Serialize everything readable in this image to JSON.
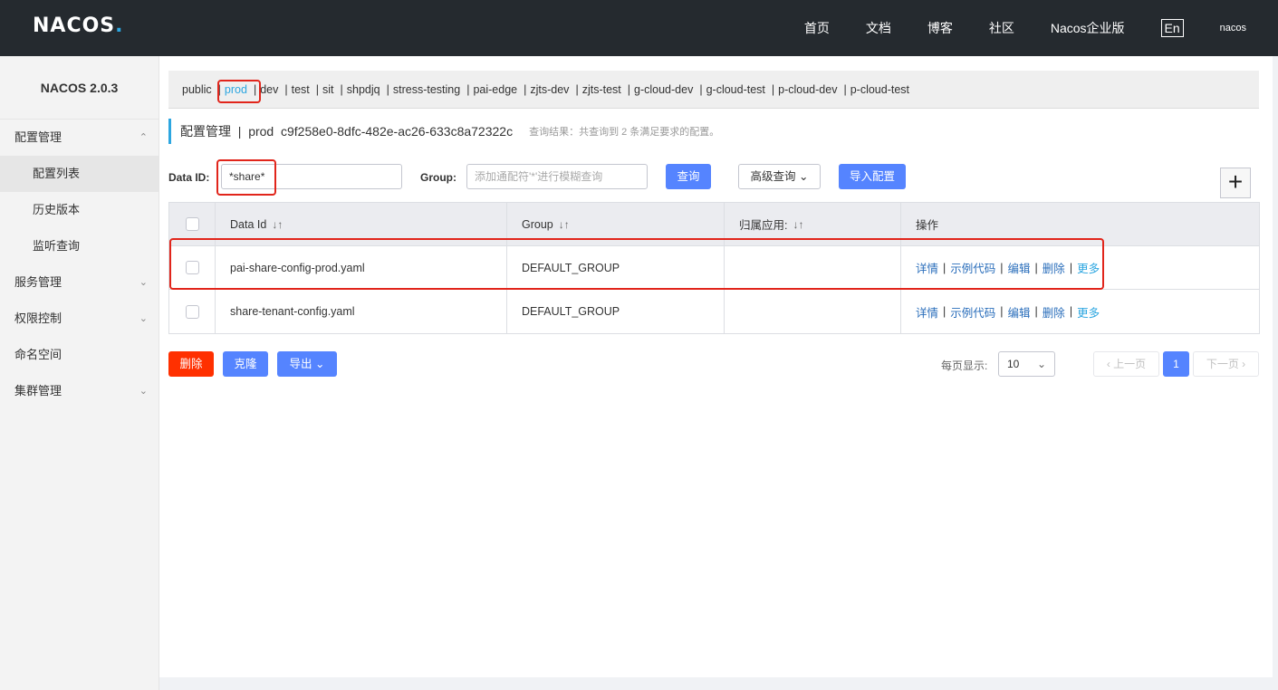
{
  "header": {
    "logo": "NACOS",
    "nav": [
      "首页",
      "文档",
      "博客",
      "社区",
      "Nacos企业版"
    ],
    "lang": "En",
    "user": "nacos"
  },
  "sidebar": {
    "version": "NACOS 2.0.3",
    "items": [
      {
        "label": "配置管理",
        "chev": "^"
      },
      {
        "label": "配置列表"
      },
      {
        "label": "历史版本"
      },
      {
        "label": "监听查询"
      },
      {
        "label": "服务管理",
        "chev": "v"
      },
      {
        "label": "权限控制",
        "chev": "v"
      },
      {
        "label": "命名空间"
      },
      {
        "label": "集群管理",
        "chev": "v"
      }
    ]
  },
  "namespaces": [
    "public",
    "prod",
    "dev",
    "test",
    "sit",
    "shpdjq",
    "stress-testing",
    "pai-edge",
    "zjts-dev",
    "zjts-test",
    "g-cloud-dev",
    "g-cloud-test",
    "p-cloud-dev",
    "p-cloud-test"
  ],
  "page_head": {
    "title": "配置管理  |  prod  c9f258e0-8dfc-482e-ac26-633c8a72322c",
    "hint": "查询结果：共查询到 2 条满足要求的配置。"
  },
  "search": {
    "data_id_label": "Data ID:",
    "data_id_value": "*share*",
    "group_label": "Group:",
    "group_placeholder": "添加通配符'*'进行模糊查询",
    "query_btn": "查询",
    "advanced_btn": "高级查询",
    "import_btn": "导入配置",
    "plus": "+"
  },
  "table": {
    "headers": [
      "Data Id",
      "Group",
      "归属应用:",
      "操作"
    ],
    "sort_icon": "↓↑",
    "rows": [
      {
        "data_id": "pai-share-config-prod.yaml",
        "group": "DEFAULT_GROUP",
        "app": ""
      },
      {
        "data_id": "share-tenant-config.yaml",
        "group": "DEFAULT_GROUP",
        "app": ""
      }
    ],
    "ops": [
      "详情",
      "示例代码",
      "编辑",
      "删除",
      "更多"
    ]
  },
  "bottom": {
    "delete_btn": "删除",
    "clone_btn": "克隆",
    "export_btn": "导出",
    "page_size_label": "每页显示:",
    "page_size": "10",
    "prev": "上一页",
    "current_page": "1",
    "next": "下一页"
  }
}
